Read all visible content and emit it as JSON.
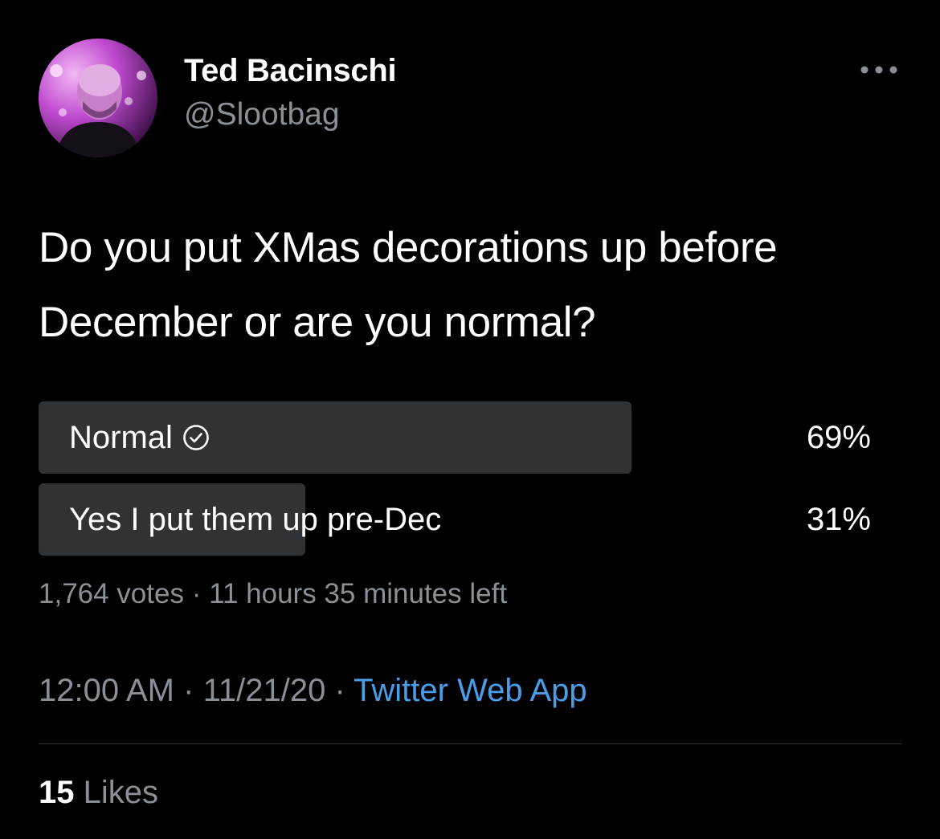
{
  "user": {
    "name": "Ted Bacinschi",
    "handle": "@Slootbag"
  },
  "tweet": {
    "text": "Do you put XMas decorations up before December or are you normal?"
  },
  "poll": {
    "options": [
      {
        "label": "Normal",
        "percent": 69,
        "percent_label": "69%",
        "selected": true
      },
      {
        "label": "Yes I put them up pre-Dec",
        "percent": 31,
        "percent_label": "31%",
        "selected": false
      }
    ],
    "votes": "1,764 votes",
    "time_left": "11 hours 35 minutes left"
  },
  "meta": {
    "time": "12:00 AM",
    "date": "11/21/20",
    "source": "Twitter Web App"
  },
  "likes": {
    "count": "15",
    "label": "Likes"
  },
  "colors": {
    "background": "#000000",
    "bar": "#2f3336",
    "link": "#4a9de8",
    "muted": "#8b9096"
  },
  "icons": {
    "more": "more-horizontal-icon",
    "check": "check-circle-icon"
  }
}
